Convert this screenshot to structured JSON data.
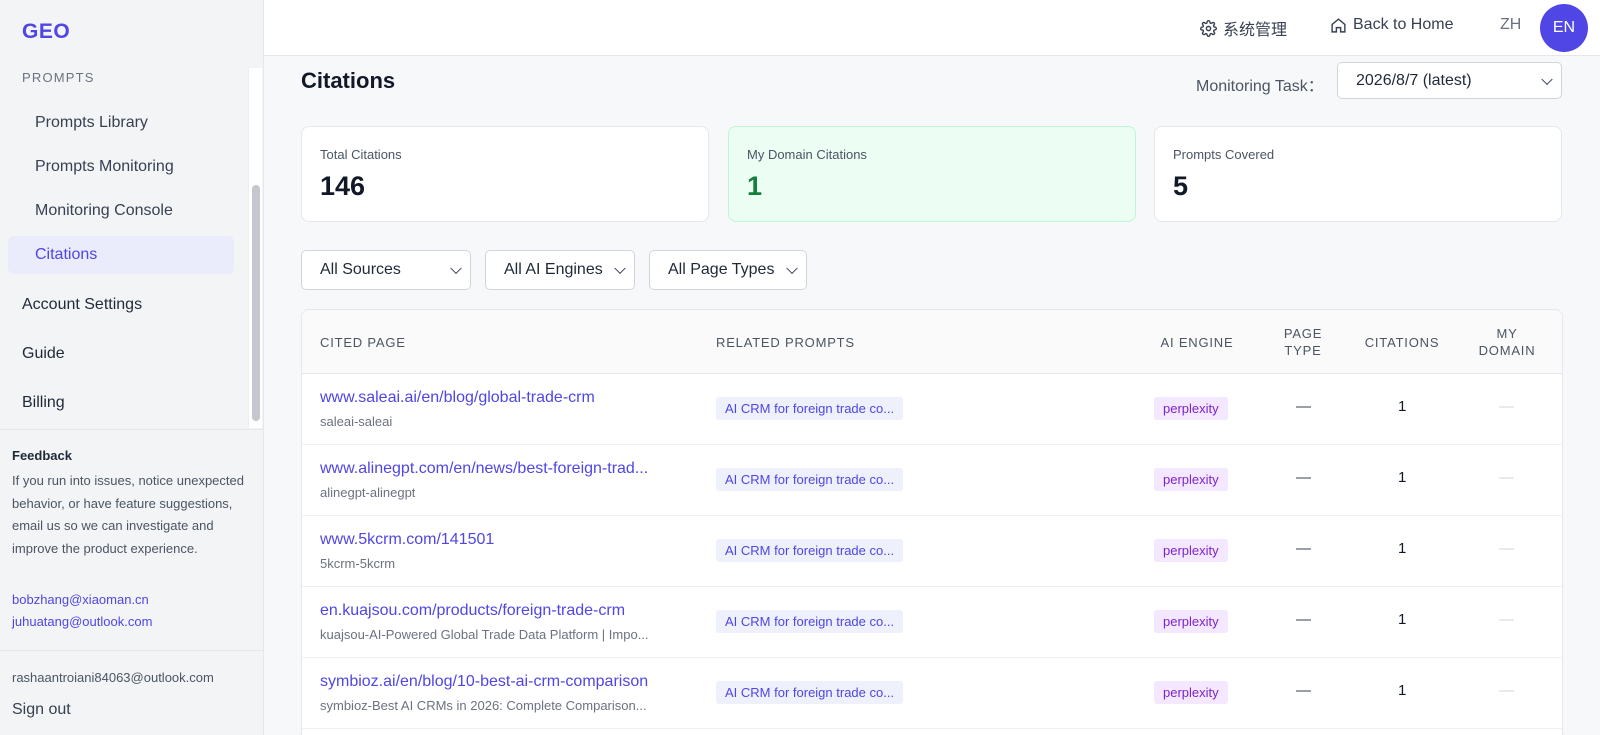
{
  "app": {
    "logo": "GEO"
  },
  "sidebar": {
    "section_label": "PROMPTS",
    "sub_items": [
      {
        "label": "Prompts Library",
        "active": false
      },
      {
        "label": "Prompts Monitoring",
        "active": false
      },
      {
        "label": "Monitoring Console",
        "active": false
      },
      {
        "label": "Citations",
        "active": true
      }
    ],
    "top_items": [
      "Account Settings",
      "Guide",
      "Billing"
    ],
    "feedback": {
      "title": "Feedback",
      "text": "If you run into issues, notice unexpected behavior, or have feature suggestions, email us so we can investigate and improve the product experience.",
      "emails": [
        "bobzhang@xiaoman.cn",
        "juhuatang@outlook.com"
      ]
    },
    "user_email": "rashaantroiani84063@outlook.com",
    "sign_out": "Sign out"
  },
  "header": {
    "system_admin": "系统管理",
    "back_home": "Back to Home",
    "lang_zh": "ZH",
    "lang_en": "EN"
  },
  "page": {
    "title": "Citations",
    "task_label": "Monitoring Task：",
    "task_value": "2026/8/7 (latest)"
  },
  "stats": [
    {
      "label": "Total Citations",
      "value": "146"
    },
    {
      "label": "My Domain Citations",
      "value": "1"
    },
    {
      "label": "Prompts Covered",
      "value": "5"
    }
  ],
  "filters": {
    "source": "All Sources",
    "engine": "All AI Engines",
    "page_type": "All Page Types"
  },
  "table": {
    "headers": {
      "cited_page": "CITED PAGE",
      "related_prompts": "RELATED PROMPTS",
      "ai_engine": "AI ENGINE",
      "page_type_1": "PAGE",
      "page_type_2": "TYPE",
      "citations": "CITATIONS",
      "my_domain_1": "MY",
      "my_domain_2": "DOMAIN"
    },
    "rows": [
      {
        "url": "www.saleai.ai/en/blog/global-trade-crm",
        "sub": "saleai-saleai",
        "prompt": "AI CRM for foreign trade co...",
        "engine": "perplexity",
        "page_type": "—",
        "citations": "1",
        "my_domain": "—"
      },
      {
        "url": "www.alinegpt.com/en/news/best-foreign-trad...",
        "sub": "alinegpt-alinegpt",
        "prompt": "AI CRM for foreign trade co...",
        "engine": "perplexity",
        "page_type": "—",
        "citations": "1",
        "my_domain": "—"
      },
      {
        "url": "www.5kcrm.com/141501",
        "sub": "5kcrm-5kcrm",
        "prompt": "AI CRM for foreign trade co...",
        "engine": "perplexity",
        "page_type": "—",
        "citations": "1",
        "my_domain": "—"
      },
      {
        "url": "en.kuajsou.com/products/foreign-trade-crm",
        "sub": "kuajsou-AI-Powered Global Trade Data Platform | Impo...",
        "prompt": "AI CRM for foreign trade co...",
        "engine": "perplexity",
        "page_type": "—",
        "citations": "1",
        "my_domain": "—"
      },
      {
        "url": "symbioz.ai/en/blog/10-best-ai-crm-comparison",
        "sub": "symbioz-Best AI CRMs in 2026: Complete Comparison...",
        "prompt": "AI CRM for foreign trade co...",
        "engine": "perplexity",
        "page_type": "—",
        "citations": "1",
        "my_domain": "—"
      }
    ]
  }
}
